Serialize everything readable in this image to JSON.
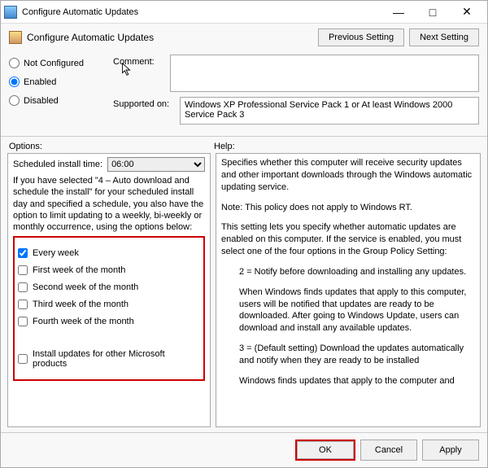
{
  "window": {
    "title": "Configure Automatic Updates"
  },
  "header": {
    "policy_name": "Configure Automatic Updates",
    "previous": "Previous Setting",
    "next": "Next Setting"
  },
  "state": {
    "not_configured": "Not Configured",
    "enabled": "Enabled",
    "disabled": "Disabled",
    "selected": "enabled"
  },
  "labels": {
    "comment": "Comment:",
    "supported_on": "Supported on:",
    "options": "Options:",
    "help": "Help:"
  },
  "comment_value": "",
  "supported_on_text": "Windows XP Professional Service Pack 1 or At least Windows 2000 Service Pack 3",
  "options": {
    "scheduled_label": "Scheduled install time:",
    "scheduled_value": "06:00",
    "desc": "If you have selected \"4 – Auto download and schedule the install\" for your scheduled install day and specified a schedule, you also have the option to limit updating to a weekly, bi-weekly or monthly occurrence, using the options below:",
    "checks": [
      {
        "label": "Every week",
        "checked": true
      },
      {
        "label": "First week of the month",
        "checked": false
      },
      {
        "label": "Second week of the month",
        "checked": false
      },
      {
        "label": "Third week of the month",
        "checked": false
      },
      {
        "label": "Fourth week of the month",
        "checked": false
      }
    ],
    "extra_check": {
      "label": "Install updates for other Microsoft products",
      "checked": false
    }
  },
  "help": {
    "p1": "Specifies whether this computer will receive security updates and other important downloads through the Windows automatic updating service.",
    "p2": "Note: This policy does not apply to Windows RT.",
    "p3": "This setting lets you specify whether automatic updates are enabled on this computer. If the service is enabled, you must select one of the four options in the Group Policy Setting:",
    "p4": "2 = Notify before downloading and installing any updates.",
    "p5": "When Windows finds updates that apply to this computer, users will be notified that updates are ready to be downloaded. After going to Windows Update, users can download and install any available updates.",
    "p6": "3 = (Default setting) Download the updates automatically and notify when they are ready to be installed",
    "p7": "Windows finds updates that apply to the computer and"
  },
  "footer": {
    "ok": "OK",
    "cancel": "Cancel",
    "apply": "Apply"
  }
}
